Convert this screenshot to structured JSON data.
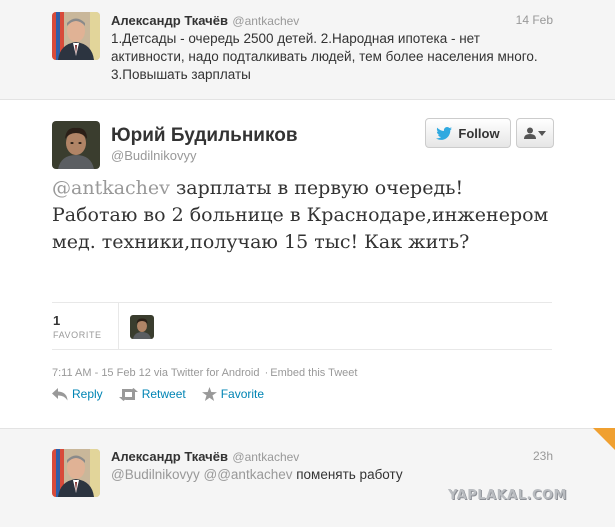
{
  "top_tweet": {
    "fullname": "Александр Ткачёв",
    "screen_name": "@antkachev",
    "time": "14 Feb",
    "text": "1.Детсады - очередь 2500 детей. 2.Народная ипотека - нет активности, надо подталкивать людей, тем более населения много. 3.Повышать зарплаты"
  },
  "main_tweet": {
    "fullname": "Юрий Будильников",
    "screen_name": "@Budilnikovyy",
    "follow_label": "Follow",
    "mention": "@antkachev",
    "text": " зарплаты в первую очередь! Работаю во 2 больнице в Краснодаре,инженером мед. техники,получаю 15 тыс! Как жить?",
    "favorite_count": "1",
    "favorite_label": "FAVORITE",
    "timestamp": "7:11 AM - 15 Feb 12",
    "via": "via Twitter for Android",
    "separator": "·",
    "embed_label": "Embed this Tweet",
    "actions": {
      "reply": "Reply",
      "retweet": "Retweet",
      "favorite": "Favorite"
    }
  },
  "bottom_tweet": {
    "fullname": "Александр Ткачёв",
    "screen_name": "@antkachev",
    "time": "23h",
    "mention1": "@Budilnikovyy",
    "mention2": "@@antkachev",
    "text": " поменять работу"
  },
  "watermark": "YAPLAKAL.COM",
  "colors": {
    "link": "#0084b4",
    "muted": "#999999",
    "background_alt": "#f5f5f5",
    "corner": "#f0a030"
  }
}
